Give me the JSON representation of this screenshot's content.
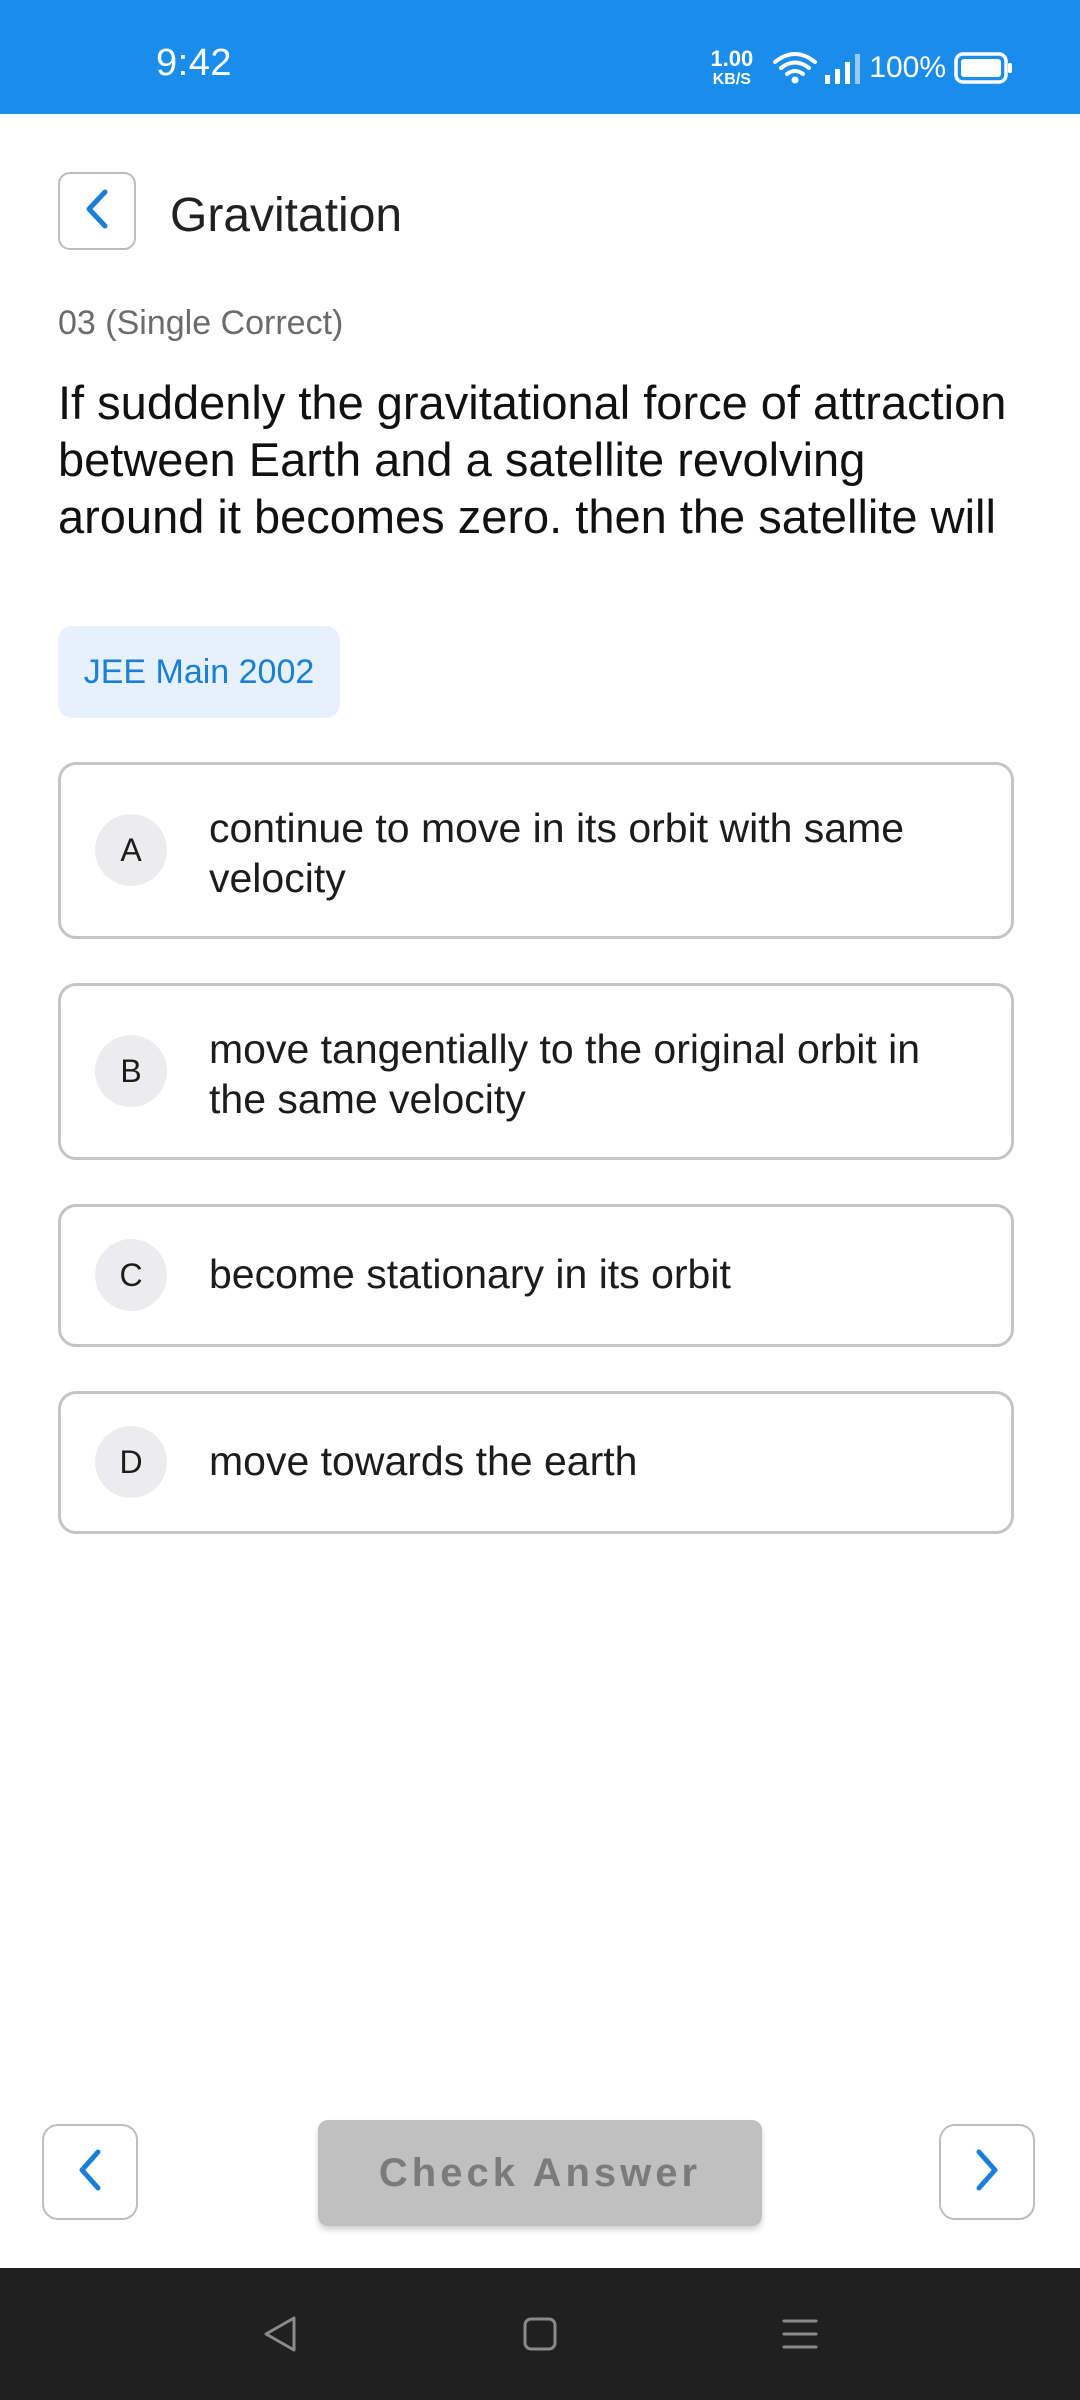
{
  "status_bar": {
    "time": "9:42",
    "net_speed_value": "1.00",
    "net_speed_unit": "KB/S",
    "battery_percent": "100%",
    "icons": [
      "wifi-icon",
      "signal-icon",
      "battery-icon"
    ],
    "background_color": "#1a8cea"
  },
  "header": {
    "back_icon": "chevron-left-icon",
    "title": "Gravitation"
  },
  "question": {
    "meta": "03 (Single Correct)",
    "text": "If suddenly the gravitational force of attraction between Earth and a satellite revolving around it becomes zero. then the satellite will",
    "exam_tag": "JEE Main 2002"
  },
  "options": [
    {
      "letter": "A",
      "text": "continue to move in its orbit with same velocity"
    },
    {
      "letter": "B",
      "text": "move tangentially to the original orbit in the same velocity"
    },
    {
      "letter": "C",
      "text": "become stationary in its orbit"
    },
    {
      "letter": "D",
      "text": "move towards the earth"
    }
  ],
  "footer": {
    "prev_icon": "chevron-left-icon",
    "next_icon": "chevron-right-icon",
    "check_answer_label": "Check Answer",
    "accent_color": "#1a7fd6"
  },
  "system_nav": {
    "icons": [
      "back-triangle-icon",
      "home-square-icon",
      "menu-lines-icon"
    ]
  }
}
